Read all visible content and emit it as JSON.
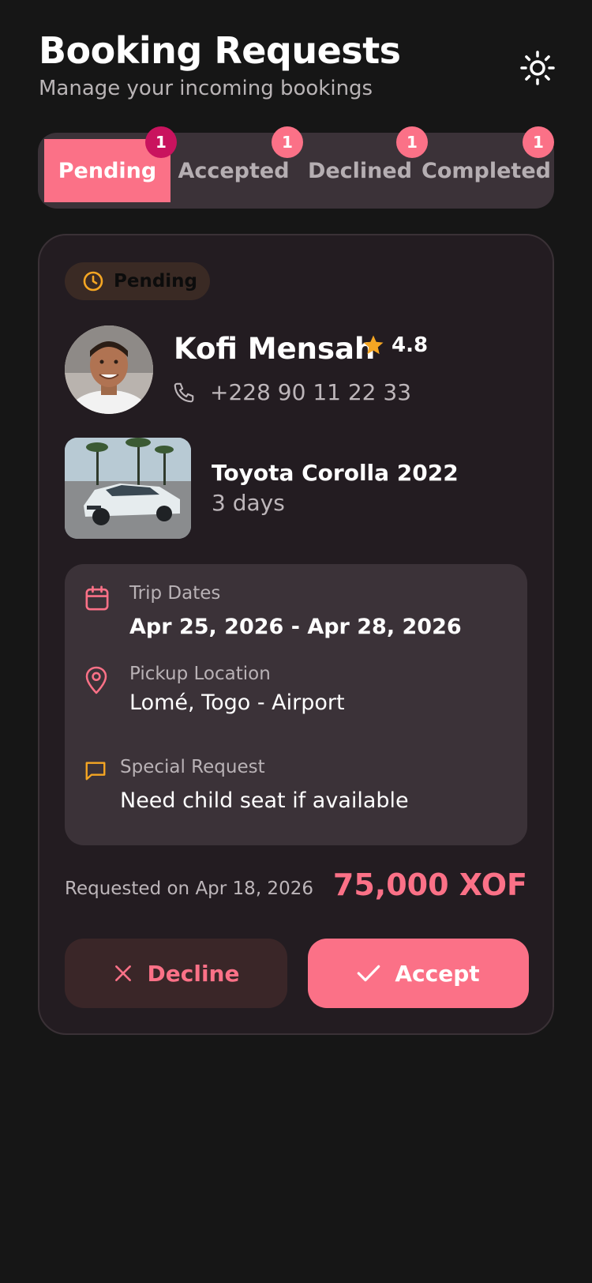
{
  "header": {
    "title": "Booking Requests",
    "subtitle": "Manage your incoming bookings",
    "theme_icon": "sun-icon"
  },
  "tabs": [
    {
      "label": "Pending",
      "count": "1",
      "active": true
    },
    {
      "label": "Accepted",
      "count": "1",
      "active": false
    },
    {
      "label": "Declined",
      "count": "1",
      "active": false
    },
    {
      "label": "Completed",
      "count": "1",
      "active": false
    }
  ],
  "booking": {
    "status": "Pending",
    "renter": {
      "name": "Kofi Mensah",
      "rating": "4.8",
      "phone": "+228 90 11 22 33"
    },
    "vehicle": {
      "name": "Toyota Corolla 2022",
      "duration": "3 days"
    },
    "trip_dates": {
      "label": "Trip Dates",
      "value": "Apr 25, 2026 - Apr 28, 2026"
    },
    "pickup": {
      "label": "Pickup Location",
      "value": "Lomé, Togo - Airport"
    },
    "special_request": {
      "label": "Special Request",
      "value": "Need child seat if available"
    },
    "requested_on": "Requested on Apr 18, 2026",
    "price": "75,000 XOF",
    "decline_label": "Decline",
    "accept_label": "Accept"
  },
  "colors": {
    "accent": "#fb7187",
    "active_badge": "#c9135e",
    "warning": "#f5a623",
    "background": "#161616",
    "card": "#231c21",
    "panel": "#3b3238"
  }
}
